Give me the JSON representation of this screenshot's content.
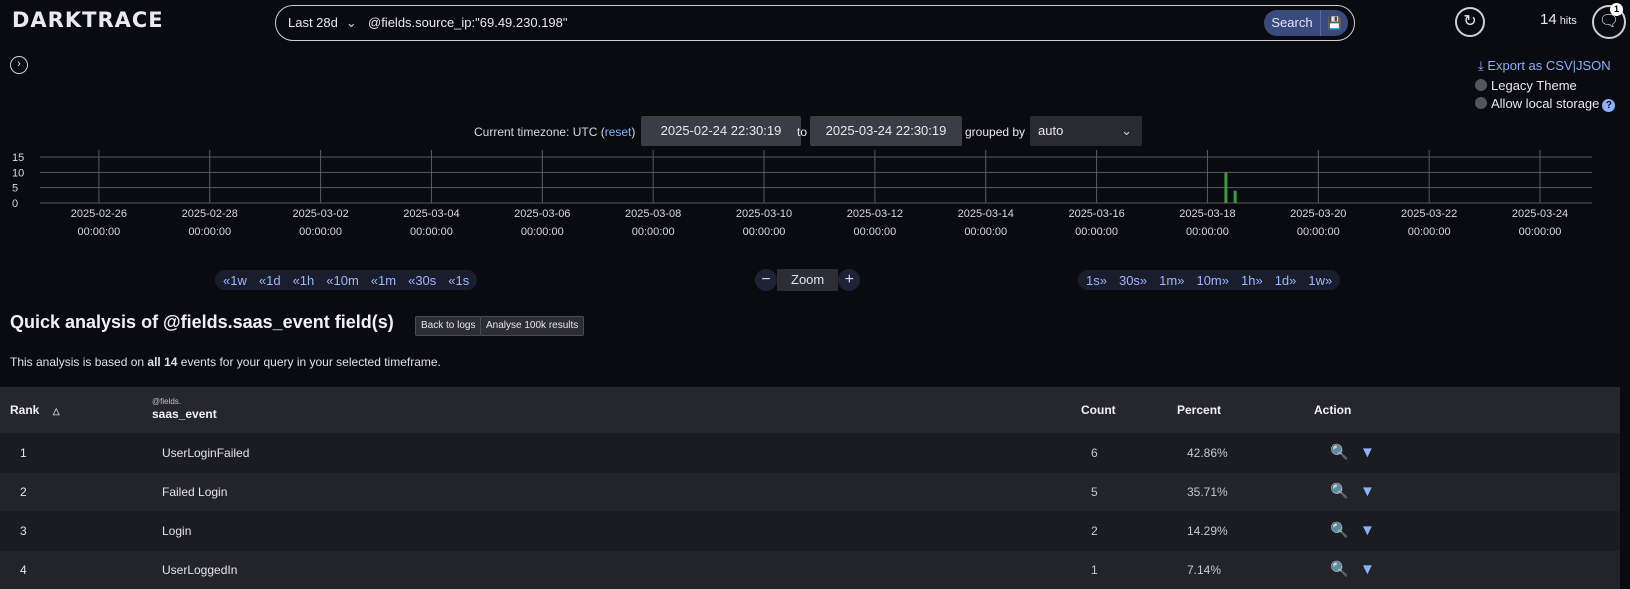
{
  "app": {
    "logo": "DARKTRACE"
  },
  "search": {
    "range": "Last 28d",
    "query": "@fields.source_ip:\"69.49.230.198\"",
    "button": "Search"
  },
  "header": {
    "hits_count": "14",
    "hits_label": "hits",
    "notification_badge": "1"
  },
  "options": {
    "export": "Export as CSV|JSON",
    "legacy_theme": "Legacy Theme",
    "allow_storage": "Allow local storage"
  },
  "time": {
    "tz_label": "Current timezone: UTC (",
    "reset": "reset",
    "tz_close": ")",
    "from": "2025-02-24 22:30:19",
    "to_label": "to",
    "to": "2025-03-24 22:30:19",
    "grouped_label": "grouped by",
    "grouped_value": "auto"
  },
  "histogram": {
    "y_ticks": [
      "15",
      "10",
      "5",
      "0"
    ],
    "x_dates": [
      "2025-02-26",
      "2025-02-28",
      "2025-03-02",
      "2025-03-04",
      "2025-03-06",
      "2025-03-08",
      "2025-03-10",
      "2025-03-12",
      "2025-03-14",
      "2025-03-16",
      "2025-03-18",
      "2025-03-20",
      "2025-03-22",
      "2025-03-24"
    ],
    "x_time": "00:00:00",
    "ymax": 15,
    "bars": [
      {
        "t": "2025-03-18 08:00",
        "count": 10
      },
      {
        "t": "2025-03-18 12:00",
        "count": 4
      }
    ],
    "color": "#3f9a3f"
  },
  "nav": {
    "back": [
      "«1w",
      "«1d",
      "«1h",
      "«10m",
      "«1m",
      "«30s",
      "«1s"
    ],
    "forward": [
      "1s»",
      "30s»",
      "1m»",
      "10m»",
      "1h»",
      "1d»",
      "1w»"
    ],
    "zoom": "Zoom"
  },
  "analysis": {
    "title": "Quick analysis of @fields.saas_event field(s)",
    "back_to_logs": "Back to logs",
    "analyse": "Analyse 100k results",
    "desc_pre": "This analysis is based on ",
    "desc_bold": "all 14",
    "desc_post": " events for your query in your selected timeframe."
  },
  "table": {
    "headers": {
      "rank": "Rank",
      "field_prefix": "@fields.",
      "field": "saas_event",
      "count": "Count",
      "percent": "Percent",
      "action": "Action"
    },
    "rows": [
      {
        "rank": "1",
        "value": "UserLoginFailed",
        "count": "6",
        "percent": "42.86%"
      },
      {
        "rank": "2",
        "value": "Failed Login",
        "count": "5",
        "percent": "35.71%"
      },
      {
        "rank": "3",
        "value": "Login",
        "count": "2",
        "percent": "14.29%"
      },
      {
        "rank": "4",
        "value": "UserLoggedIn",
        "count": "1",
        "percent": "7.14%"
      }
    ]
  }
}
